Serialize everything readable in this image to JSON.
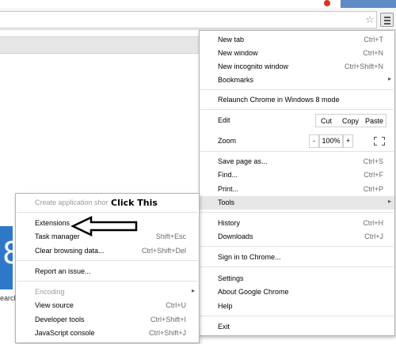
{
  "main_menu": {
    "items": [
      {
        "label": "New tab",
        "shortcut": "Ctrl+T"
      },
      {
        "label": "New window",
        "shortcut": "Ctrl+N"
      },
      {
        "label": "New incognito window",
        "shortcut": "Ctrl+Shift+N"
      },
      {
        "label": "Bookmarks",
        "submenu": true
      },
      {
        "label": "Relaunch Chrome in Windows 8 mode"
      },
      {
        "label": "Edit"
      },
      {
        "label": "Zoom"
      },
      {
        "label": "Save page as...",
        "shortcut": "Ctrl+S"
      },
      {
        "label": "Find...",
        "shortcut": "Ctrl+F"
      },
      {
        "label": "Print...",
        "shortcut": "Ctrl+P"
      },
      {
        "label": "Tools",
        "submenu": true,
        "highlighted": true
      },
      {
        "label": "History",
        "shortcut": "Ctrl+H"
      },
      {
        "label": "Downloads",
        "shortcut": "Ctrl+J"
      },
      {
        "label": "Sign in to Chrome..."
      },
      {
        "label": "Settings"
      },
      {
        "label": "About Google Chrome"
      },
      {
        "label": "Help"
      },
      {
        "label": "Exit"
      }
    ],
    "edit": {
      "cut": "Cut",
      "copy": "Copy",
      "paste": "Paste"
    },
    "zoom": {
      "minus": "-",
      "level": "100%",
      "plus": "+"
    }
  },
  "tools_submenu": {
    "items": [
      {
        "label": "Create application shortcuts...",
        "disabled": true
      },
      {
        "label": "Extensions"
      },
      {
        "label": "Task manager",
        "shortcut": "Shift+Esc"
      },
      {
        "label": "Clear browsing data...",
        "shortcut": "Ctrl+Shift+Del"
      },
      {
        "label": "Report an issue..."
      },
      {
        "label": "Encoding",
        "disabled": true,
        "submenu": true
      },
      {
        "label": "View source",
        "shortcut": "Ctrl+U"
      },
      {
        "label": "Developer tools",
        "shortcut": "Ctrl+Shift+I"
      },
      {
        "label": "JavaScript console",
        "shortcut": "Ctrl+Shift+J"
      }
    ]
  },
  "annotation": {
    "text": "Click This"
  },
  "page": {
    "partial_text": "earch"
  },
  "icons": {
    "star": "star-icon",
    "menu": "hamburger-menu-icon",
    "fullscreen": "fullscreen-icon",
    "submenu": "chevron-right-icon"
  },
  "colors": {
    "highlight": "#e6e6e6",
    "menu_border": "#b4b4b4",
    "shortcut_text": "#6a6a6a",
    "disabled_text": "#9a9a9a",
    "logo_blue": "#2f78c9"
  }
}
